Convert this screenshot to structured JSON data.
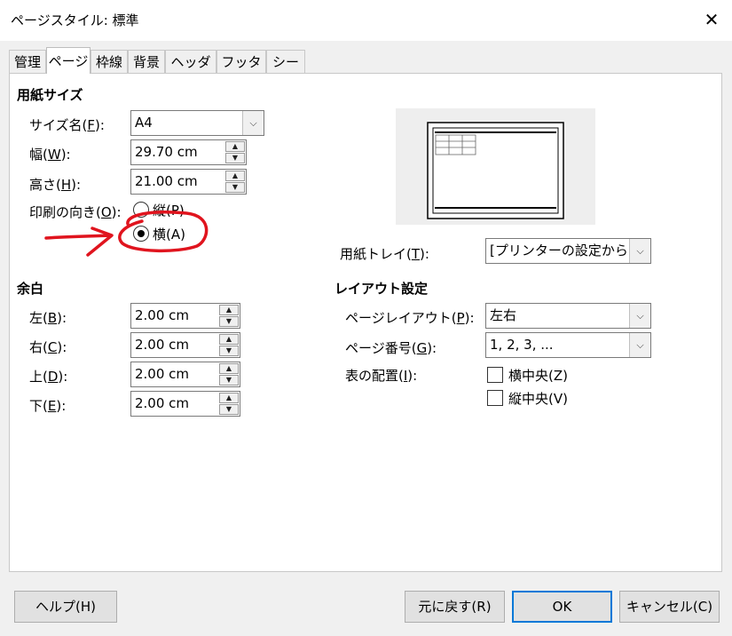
{
  "window": {
    "title": "ページスタイル: 標準",
    "close_glyph": "✕"
  },
  "tabs": [
    {
      "label": "管理"
    },
    {
      "label": "ページ"
    },
    {
      "label": "枠線"
    },
    {
      "label": "背景"
    },
    {
      "label": "ヘッダー"
    },
    {
      "label": "フッター"
    },
    {
      "label": "シート"
    }
  ],
  "paper": {
    "heading": "用紙サイズ",
    "size_name": {
      "label_pre": "サイズ名(",
      "key": "F",
      "label_post": "):",
      "value": "A4"
    },
    "width": {
      "label_pre": "幅(",
      "key": "W",
      "label_post": "):",
      "value": "29.70 cm"
    },
    "height": {
      "label_pre": "高さ(",
      "key": "H",
      "label_post": "):",
      "value": "21.00 cm"
    },
    "orientation": {
      "label_pre": "印刷の向き(",
      "key": "O",
      "label_post": "):",
      "portrait": {
        "label": "縦(P)",
        "selected": false
      },
      "landscape": {
        "label": "横(A)",
        "selected": true
      }
    },
    "tray": {
      "label_pre": "用紙トレイ(",
      "key": "T",
      "label_post": "):",
      "value": "[プリンターの設定から]"
    }
  },
  "margins": {
    "heading": "余白",
    "left": {
      "label_pre": "左(",
      "key": "B",
      "label_post": "):",
      "value": "2.00 cm"
    },
    "right": {
      "label_pre": "右(",
      "key": "C",
      "label_post": "):",
      "value": "2.00 cm"
    },
    "top": {
      "label_pre": "上(",
      "key": "D",
      "label_post": "):",
      "value": "2.00 cm"
    },
    "bottom": {
      "label_pre": "下(",
      "key": "E",
      "label_post": "):",
      "value": "2.00 cm"
    }
  },
  "layout": {
    "heading": "レイアウト設定",
    "page_layout": {
      "label_pre": "ページレイアウト(",
      "key": "P",
      "label_post": "):",
      "value": "左右"
    },
    "page_number": {
      "label_pre": "ページ番号(",
      "key": "G",
      "label_post": "):",
      "value": "1, 2, 3, ..."
    },
    "table_alignment": {
      "label_pre": "表の配置(",
      "key": "I",
      "label_post": "):",
      "horizontal": {
        "label": "横中央(Z)",
        "checked": false
      },
      "vertical": {
        "label": "縦中央(V)",
        "checked": false
      }
    }
  },
  "buttons": {
    "help": "ヘルプ(H)",
    "reset": "元に戻す(R)",
    "ok": "OK",
    "cancel": "キャンセル(C)"
  },
  "annotation": {
    "color": "#e0141e"
  }
}
